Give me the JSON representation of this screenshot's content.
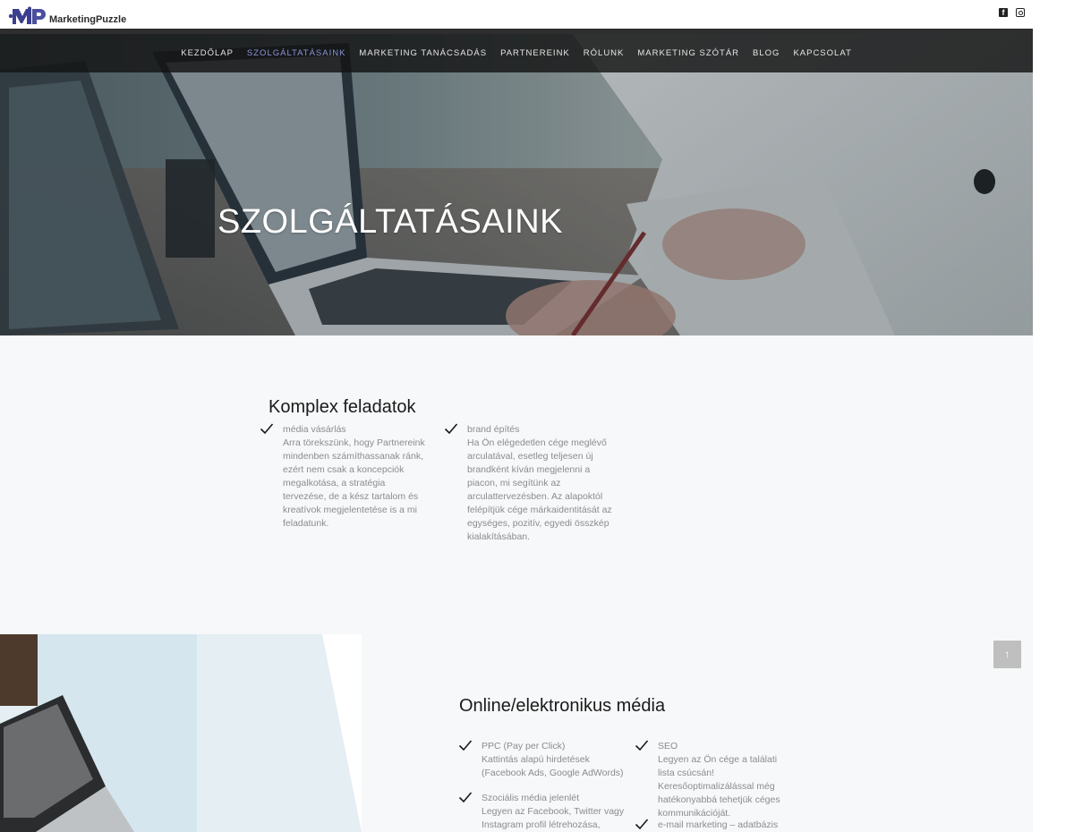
{
  "brand": {
    "name": "MarketingPuzzle"
  },
  "social": {
    "facebook": "f",
    "instagram_icon": "instagram-icon"
  },
  "nav": {
    "items": [
      {
        "label": "KEZDŐLAP"
      },
      {
        "label": "SZOLGÁLTATÁSAINK",
        "active": true
      },
      {
        "label": "MARKETING TANÁCSADÁS"
      },
      {
        "label": "PARTNEREINK"
      },
      {
        "label": "RÓLUNK"
      },
      {
        "label": "MARKETING SZÓTÁR"
      },
      {
        "label": "BLOG"
      },
      {
        "label": "KAPCSOLAT"
      }
    ]
  },
  "hero": {
    "title": "SZOLGÁLTATÁSAINK"
  },
  "section1": {
    "title": "Komplex feladatok",
    "items": [
      {
        "head": "média vásárlás",
        "body": "Arra törekszünk, hogy Partnereink mindenben számíthassanak ránk, ezért nem csak a koncepciók megalkotása, a stratégia tervezése, de a kész tartalom és kreatívok megjelentetése is a mi feladatunk."
      },
      {
        "head": "brand építés",
        "body": "Ha Ön elégedetlen cége meglévő arculatával, esetleg teljesen új brandként kíván megjelenni a piacon, mi segítünk az arculattervezésben. Az alapoktól felépítjük cége márkaidentitását az egységes, pozitív, egyedi összkép kialakításában."
      }
    ]
  },
  "section2": {
    "title": "Online/elektronikus média",
    "items": [
      {
        "head": "PPC (Pay per Click)",
        "body": "Kattintás alapú hirdetések (Facebook Ads, Google AdWords)"
      },
      {
        "head": "SEO",
        "body": "Legyen az Ön cége a találati lista csúcsán! Keresőoptimalizálással még hatékonyabbá tehetjük céges kommunikációját."
      },
      {
        "head": "Szociális média jelenlét",
        "body": "Legyen az Facebook, Twitter vagy Instagram profil létrehozása,"
      },
      {
        "head": "e-mail marketing – adatbázis",
        "body": ""
      }
    ]
  },
  "scroll_top": {
    "label": "↑"
  },
  "colors": {
    "accent": "#8f96d9",
    "nav_bg": "#1e1e1e",
    "content_bg": "#f6f8f9"
  }
}
